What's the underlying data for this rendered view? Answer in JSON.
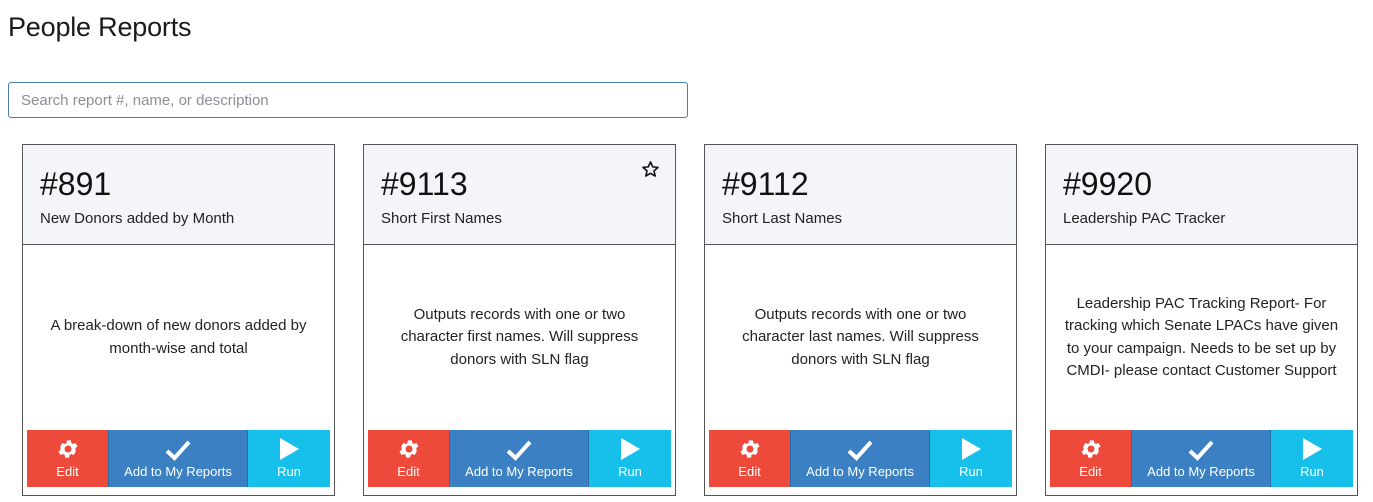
{
  "page": {
    "title": "People Reports"
  },
  "search": {
    "placeholder": "Search report #, name, or description",
    "value": ""
  },
  "colors": {
    "edit": "#ee4a3c",
    "add": "#3a80c3",
    "run": "#17c0eb",
    "card_header": "#f4f5f9"
  },
  "cards": [
    {
      "number": "#891",
      "name": "New Donors added by Month",
      "description": "A break-down of new donors added by month-wise and total",
      "favorite_icon": "",
      "actions": {
        "edit": "Edit",
        "add": "Add to My Reports",
        "run": "Run"
      }
    },
    {
      "number": "#9113",
      "name": "Short First Names",
      "description": "Outputs records with one or two character first names. Will suppress donors with SLN flag",
      "favorite_icon": "star-outline-icon",
      "actions": {
        "edit": "Edit",
        "add": "Add to My Reports",
        "run": "Run"
      }
    },
    {
      "number": "#9112",
      "name": "Short Last Names",
      "description": "Outputs records with one or two character last names. Will suppress donors with SLN flag",
      "favorite_icon": "",
      "actions": {
        "edit": "Edit",
        "add": "Add to My Reports",
        "run": "Run"
      }
    },
    {
      "number": "#9920",
      "name": "Leadership PAC Tracker",
      "description": "Leadership PAC Tracking Report- For tracking which Senate LPACs have given to your campaign. Needs to be set up by CMDI- please contact Customer Support",
      "favorite_icon": "",
      "actions": {
        "edit": "Edit",
        "add": "Add to My Reports",
        "run": "Run"
      }
    }
  ]
}
